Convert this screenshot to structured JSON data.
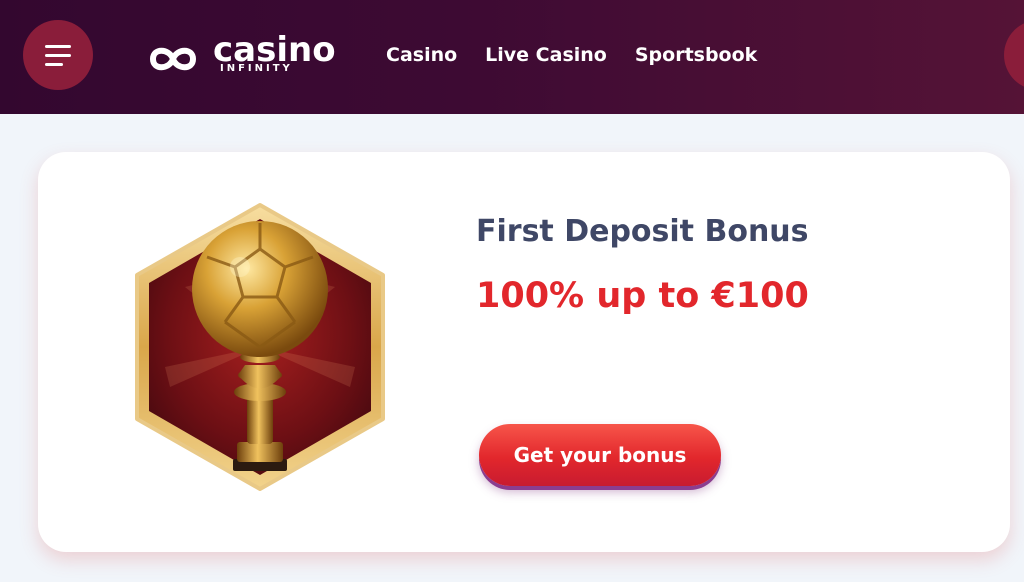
{
  "header": {
    "logo": {
      "word": "casino",
      "sub": "INFINITY"
    },
    "nav": [
      "Casino",
      "Live Casino",
      "Sportsbook"
    ]
  },
  "promo": {
    "title": "First Deposit Bonus",
    "amount": "100% up to €100",
    "cta_label": "Get your bonus",
    "image_icon": "golden-football-trophy-icon"
  },
  "colors": {
    "header_bg": "#3d0a33",
    "accent_red": "#e2272c",
    "title_text": "#3f4766",
    "menu_button": "#8a1d3a"
  }
}
